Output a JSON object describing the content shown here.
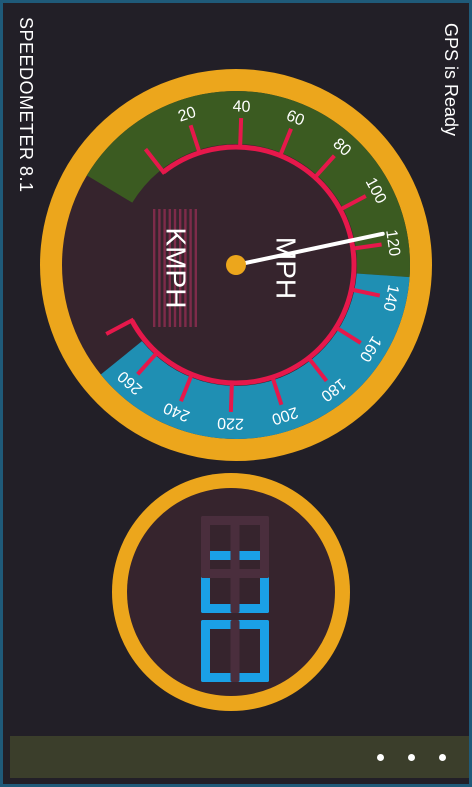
{
  "app": {
    "title": "SPEEDOMETER 8.1"
  },
  "status": {
    "gps": "GPS is Ready"
  },
  "gauge": {
    "unit_kmph": "KMPH",
    "unit_mph": "MPH",
    "scale_min": 0,
    "scale_max": 280,
    "tick_labels": [
      "20",
      "40",
      "60",
      "80",
      "100",
      "120",
      "140",
      "160",
      "180",
      "200",
      "220",
      "240",
      "260"
    ],
    "needle_value": 116,
    "colors": {
      "ring": "#eca61c",
      "low_zone": "#3b5b21",
      "high_zone": "#1f8fb3",
      "ticks": "#e6184b",
      "dial": "#36242d",
      "needle": "#ffffff"
    }
  },
  "digital": {
    "speed": "00",
    "colors": {
      "lit": "#1aa0e6",
      "unlit": "#4a2e3d",
      "ring": "#eca61c",
      "face": "#36242d"
    }
  },
  "appbar": {
    "menu_icon": "more-ellipsis-icon"
  }
}
